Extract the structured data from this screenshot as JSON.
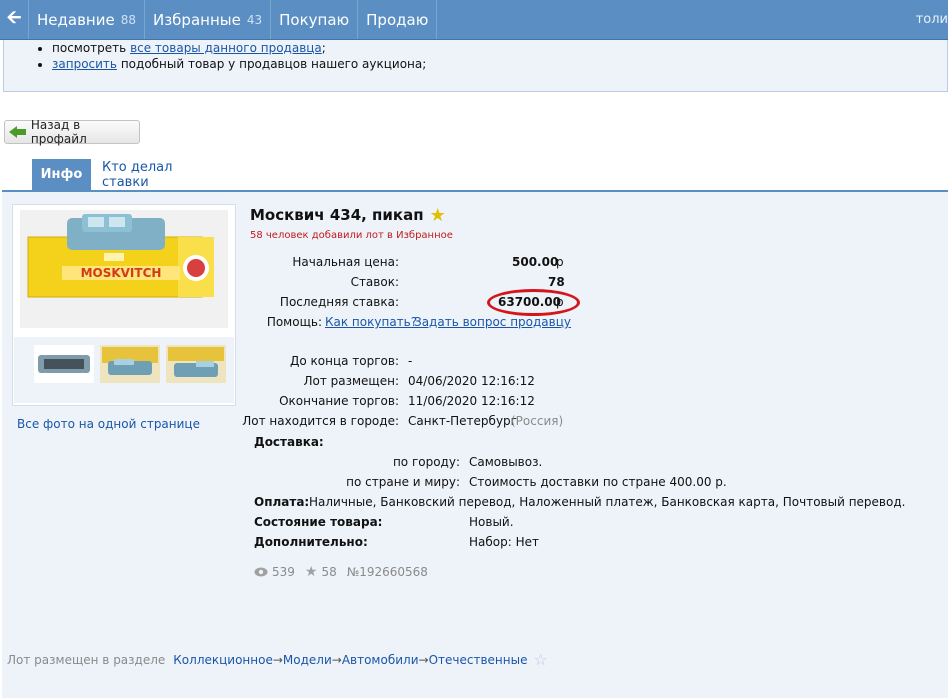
{
  "nav": {
    "back_icon": "arrow-left",
    "items": [
      {
        "label": "Недавние",
        "count": "88"
      },
      {
        "label": "Избранные",
        "count": "43"
      },
      {
        "label": "Покупаю",
        "count": ""
      },
      {
        "label": "Продаю",
        "count": ""
      }
    ],
    "right_text": "толи"
  },
  "infobox": {
    "line1_prefix": "посмотреть",
    "line1_link": "все товары данного продавца",
    "line1_suffix": ";",
    "line2_link": "запросить",
    "line2_suffix": "подобный товар у продавцов нашего аукциона;"
  },
  "back_button": {
    "label": "Назад в профайл",
    "icon": "green-arrow-left-icon"
  },
  "tabs": [
    {
      "label": "Инфо",
      "active": true
    },
    {
      "label": "Кто делал ставки",
      "active": false
    }
  ],
  "photos": {
    "all_photos_link": "Все фото на одной странице",
    "box_label": "MOSKVITCH"
  },
  "lot": {
    "title": "Москвич 434, пикап",
    "favorites_note": "58 человек добавили лот в Избранное",
    "start_price_label": "Начальная цена:",
    "start_price_value": "500.00",
    "start_price_currency": "р",
    "bids_label": "Ставок:",
    "bids_value": "78",
    "last_bid_label": "Последняя ставка:",
    "last_bid_value": "63700.00",
    "last_bid_currency": "р",
    "help_label": "Помощь:",
    "help_link1": "Как покупать?",
    "help_link2": "Задать вопрос продавцу",
    "time_left_label": "До конца торгов:",
    "time_left_value": "-",
    "placed_label": "Лот размещен:",
    "placed_value": "04/06/2020 12:16:12",
    "ends_label": "Окончание торгов:",
    "ends_value": "11/06/2020 12:16:12",
    "city_label": "Лот находится в городе:",
    "city_value": "Санкт-Петербург",
    "country_value": "(Россия)",
    "delivery_label": "Доставка:",
    "delivery_city_label": "по городу:",
    "delivery_city_value": "Самовывоз.",
    "delivery_world_label": "по стране и миру:",
    "delivery_world_value": "Стоимость доставки по стране 400.00 р.",
    "payment_label": "Оплата:",
    "payment_value": "Наличные, Банковский перевод, Наложенный платеж, Банковская карта, Почтовый перевод.",
    "condition_label": "Состояние товара:",
    "condition_value": "Новый.",
    "extra_label": "Дополнительно:",
    "extra_value": "Набор: Нет",
    "views": "539",
    "stars": "58",
    "lot_number": "№192660568"
  },
  "footer": {
    "prefix": "Лот размещен в разделе",
    "crumbs": [
      "Коллекционное",
      "Модели",
      "Автомобили",
      "Отечественные"
    ],
    "separator": "→"
  },
  "colors": {
    "nav_bg": "#5b8fc4",
    "panel_bg": "#eef3fa",
    "link": "#1a56a8",
    "highlight_red": "#d4161c"
  }
}
